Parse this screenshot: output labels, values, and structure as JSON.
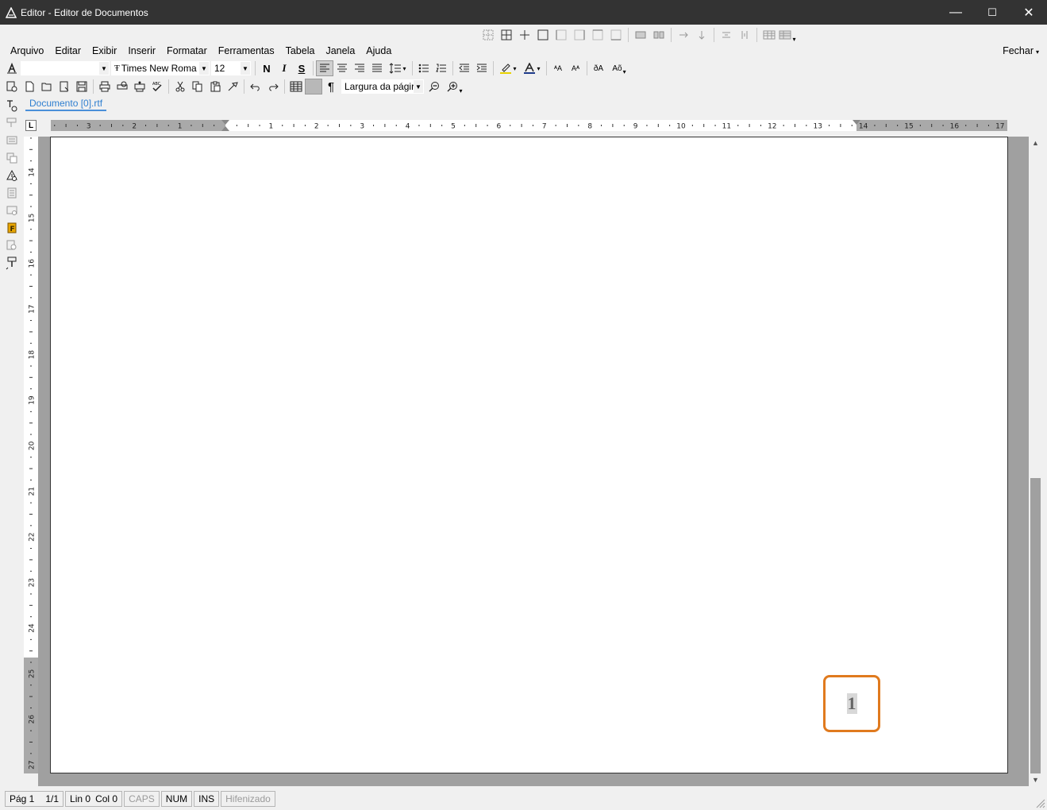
{
  "window": {
    "title": "Editor - Editor de Documentos",
    "minimize": "—",
    "maximize": "☐",
    "close": "✕"
  },
  "menu": {
    "items": [
      "Arquivo",
      "Editar",
      "Exibir",
      "Inserir",
      "Formatar",
      "Ferramentas",
      "Tabela",
      "Janela",
      "Ajuda"
    ],
    "close_label": "Fechar"
  },
  "toolbar": {
    "style_value": "",
    "font_value": "Times New Roma",
    "size_value": "12",
    "bold": "N",
    "italic": "I",
    "strike": "S",
    "pilcrow": "¶",
    "zoom_value": "Largura da págir"
  },
  "document_tab": "Documento [0].rtf",
  "ruler": {
    "corner": "L",
    "h_left_numbers": [
      "3",
      "2",
      "1"
    ],
    "h_numbers": [
      "1",
      "2",
      "3",
      "4",
      "5",
      "6",
      "7",
      "8",
      "9",
      "10",
      "11",
      "12",
      "13",
      "14",
      "15",
      "16",
      "17"
    ],
    "v_numbers": [
      "14",
      "15",
      "16",
      "17",
      "18",
      "19",
      "20",
      "21",
      "22",
      "23",
      "24",
      "25",
      "26",
      "27"
    ]
  },
  "page": {
    "page_number": "1"
  },
  "status": {
    "page": "Pág 1",
    "pages": "1/1",
    "line": "Lin 0",
    "col": "Col 0",
    "caps": "CAPS",
    "num": "NUM",
    "ins": "INS",
    "hyphen": "Hifenizado"
  },
  "colors": {
    "titlebar": "#333333",
    "accent_tab": "#2f7fd0",
    "highlight_box": "#e07a1e",
    "workspace": "#a0a0a0"
  }
}
